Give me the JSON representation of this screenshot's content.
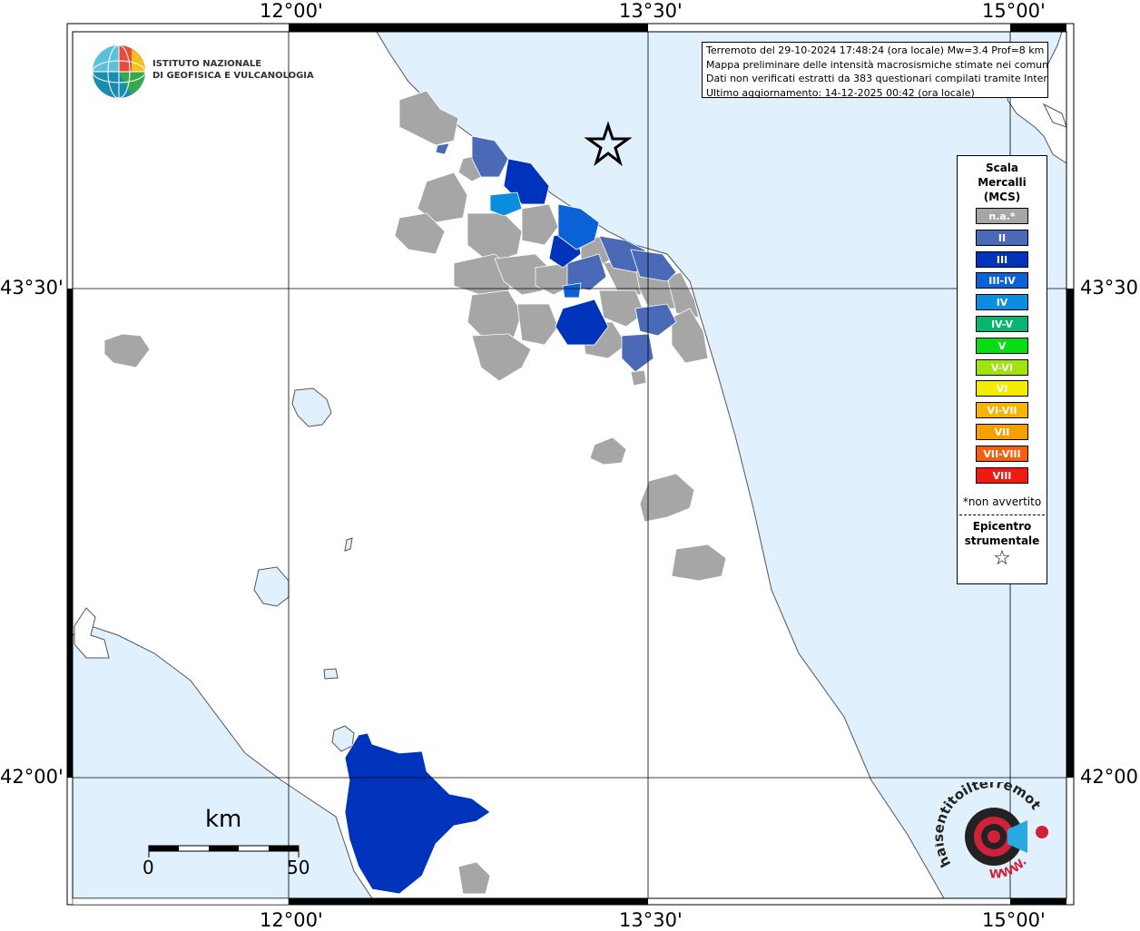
{
  "map_info": {
    "line1": "Terremoto del 29-10-2024 17:48:24 (ora locale) Mw=3.4 Prof=8 km",
    "line2": "Mappa preliminare delle intensità macrosismiche stimate nei comuni",
    "line3": "Dati non verificati estratti da 383 questionari compilati tramite Internet.",
    "line4": "Ultimo aggiornamento: 14-12-2025 00:42 (ora locale)"
  },
  "logo": {
    "line1": "ISTITUTO NAZIONALE",
    "line2": "DI GEOFISICA E VULCANOLOGIA"
  },
  "axes": {
    "top": [
      "12°00'",
      "13°30'",
      "15°00'"
    ],
    "bottom": [
      "12°00'",
      "13°30'",
      "15°00'"
    ],
    "left": [
      "43°30'",
      "42°00'"
    ],
    "right": [
      "43°30'",
      "42°00'"
    ]
  },
  "legend": {
    "title_line1": "Scala",
    "title_line2": "Mercalli",
    "title_line3": "(MCS)",
    "items": [
      {
        "label": "n.a.*",
        "color": "#a6a6a6"
      },
      {
        "label": "II",
        "color": "#4a6ab8"
      },
      {
        "label": "III",
        "color": "#0033bb"
      },
      {
        "label": "III-IV",
        "color": "#0a62d6"
      },
      {
        "label": "IV",
        "color": "#0c8ee0"
      },
      {
        "label": "IV-V",
        "color": "#07b470"
      },
      {
        "label": "V",
        "color": "#06dd12"
      },
      {
        "label": "V-VI",
        "color": "#a0e40a"
      },
      {
        "label": "VI",
        "color": "#f3ec00"
      },
      {
        "label": "VI-VII",
        "color": "#f4b400"
      },
      {
        "label": "VII",
        "color": "#f6a000"
      },
      {
        "label": "VII-VIII",
        "color": "#f46010"
      },
      {
        "label": "VIII",
        "color": "#f21a10"
      }
    ],
    "note": "*non avvertito",
    "epicentre_line1": "Epicentro",
    "epicentre_line2": "strumentale",
    "star_symbol": "☆"
  },
  "scale_bar": {
    "unit": "km",
    "min": "0",
    "max": "50"
  },
  "brand": {
    "text1": "haisentitoilterremoto.it",
    "text2": "WWW."
  },
  "colors": {
    "sea": "#e0f0fc",
    "land": "#ffffff",
    "na": "#a6a6a6",
    "ii": "#4a6ab8",
    "iii": "#0033bb",
    "iii_iv": "#0a62d6",
    "iv": "#0c8ee0"
  }
}
